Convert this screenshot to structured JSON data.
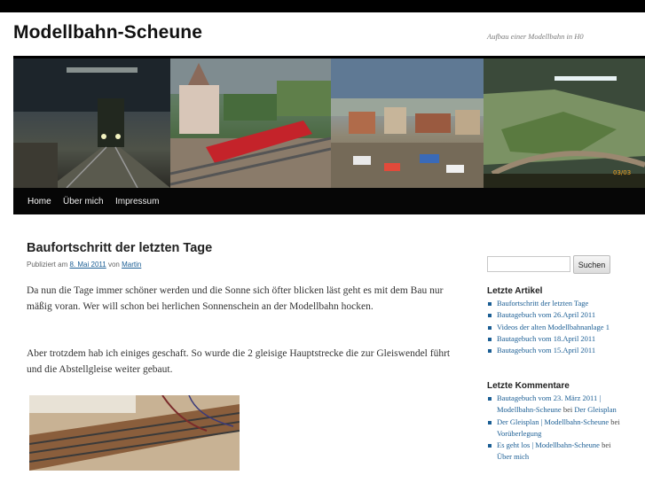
{
  "site": {
    "title": "Modellbahn-Scheune",
    "description": "Aufbau einer Modellbahn in H0"
  },
  "nav": {
    "items": [
      {
        "label": "Home"
      },
      {
        "label": "Über mich"
      },
      {
        "label": "Impressum"
      }
    ]
  },
  "post": {
    "title": "Baufortschritt der letzten Tage",
    "meta_prefix": "Publiziert am",
    "date": "8. Mai 2011",
    "meta_by": "von",
    "author": "Martin",
    "paragraphs": [
      "Da nun die Tage immer schöner werden und die Sonne sich öfter blicken läst geht es mit dem Bau nur mäßig voran. Wer will schon bei herlichen Sonnenschein an der Modellbahn hocken.",
      "Aber trotzdem hab ich einiges geschaft. So wurde die 2 gleisige Hauptstrecke die zur Gleiswendel führt und die Abstellgleise weiter gebaut."
    ]
  },
  "sidebar": {
    "search_placeholder": "",
    "search_button": "Suchen",
    "recent_posts_title": "Letzte Artikel",
    "recent_posts": [
      "Baufortschritt der letzten Tage",
      "Bautagebuch vom 26.April 2011",
      "Videos der alten Modellbahnanlage 1",
      "Bautagebuch vom 18.April 2011",
      "Bautagebuch vom 15.April 2011"
    ],
    "recent_comments_title": "Letzte Kommentare",
    "recent_comments": [
      {
        "source": "Bautagebuch vom 23. März 2011 | Modellbahn-Scheune",
        "by": "bei",
        "target": "Der Gleisplan"
      },
      {
        "source": "Der Gleisplan | Modellbahn-Scheune",
        "by": "bei",
        "target": "Vorüberlegung"
      },
      {
        "source": "Es geht los | Modellbahn-Scheune",
        "by": "bei",
        "target": "Über mich"
      }
    ]
  },
  "banner": {
    "timestamp": "03/03"
  },
  "colors": {
    "link": "#1b5e94",
    "nav_bg": "#060606",
    "top_bar": "#000000"
  }
}
